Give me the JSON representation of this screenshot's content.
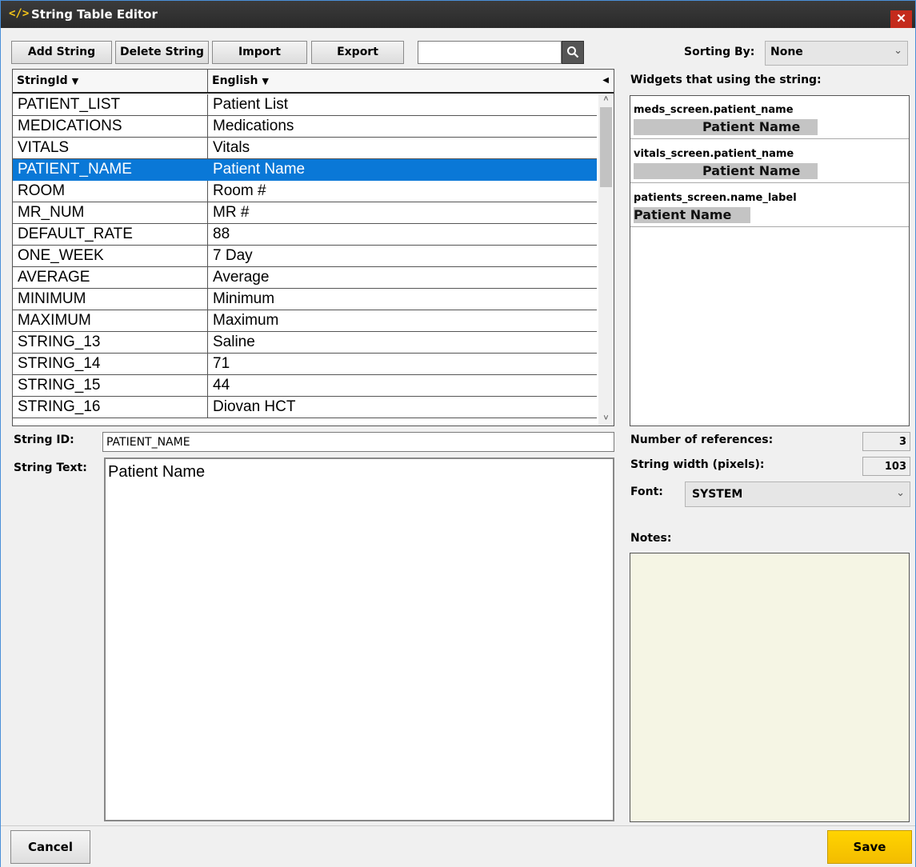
{
  "window": {
    "icon_text": "</>",
    "title": "String Table Editor",
    "close_glyph": "✕"
  },
  "toolbar": {
    "add_label": "Add String",
    "delete_label": "Delete String",
    "import_label": "Import",
    "export_label": "Export",
    "search_value": "",
    "search_icon": "magnifier-icon",
    "sorting_label": "Sorting By:",
    "sorting_value": "None"
  },
  "table": {
    "col_id": "StringId",
    "col_english": "English",
    "sort_glyph": "▼",
    "rows": [
      {
        "id": "PATIENT_LIST",
        "text": "Patient List"
      },
      {
        "id": "MEDICATIONS",
        "text": "Medications"
      },
      {
        "id": "VITALS",
        "text": "Vitals"
      },
      {
        "id": "PATIENT_NAME",
        "text": "Patient Name",
        "selected": true
      },
      {
        "id": "ROOM",
        "text": "Room #"
      },
      {
        "id": "MR_NUM",
        "text": "MR #"
      },
      {
        "id": "DEFAULT_RATE",
        "text": "88"
      },
      {
        "id": "ONE_WEEK",
        "text": "7 Day"
      },
      {
        "id": "AVERAGE",
        "text": "Average"
      },
      {
        "id": "MINIMUM",
        "text": "Minimum"
      },
      {
        "id": "MAXIMUM",
        "text": "Maximum"
      },
      {
        "id": "STRING_13",
        "text": "Saline"
      },
      {
        "id": "STRING_14",
        "text": "71"
      },
      {
        "id": "STRING_15",
        "text": "44"
      },
      {
        "id": "STRING_16",
        "text": "Diovan HCT"
      }
    ]
  },
  "editor": {
    "string_id_label": "String ID:",
    "string_id_value": "PATIENT_NAME",
    "string_text_label": "String Text:",
    "string_text_value": "Patient Name"
  },
  "widgets": {
    "header": "Widgets that using the string:",
    "items": [
      {
        "path": "meds_screen.patient_name",
        "preview": "Patient Name"
      },
      {
        "path": "vitals_screen.patient_name",
        "preview": "Patient Name"
      },
      {
        "path": "patients_screen.name_label",
        "preview": "Patient Name"
      }
    ]
  },
  "info": {
    "refs_label": "Number of references:",
    "refs_value": "3",
    "width_label": "String width (pixels):",
    "width_value": "103",
    "font_label": "Font:",
    "font_value": "SYSTEM",
    "notes_label": "Notes:",
    "notes_value": ""
  },
  "footer": {
    "cancel_label": "Cancel",
    "save_label": "Save"
  },
  "colors": {
    "selection": "#0a78d7",
    "save_button": "#ffd400",
    "notes_bg": "#f5f5e4"
  }
}
